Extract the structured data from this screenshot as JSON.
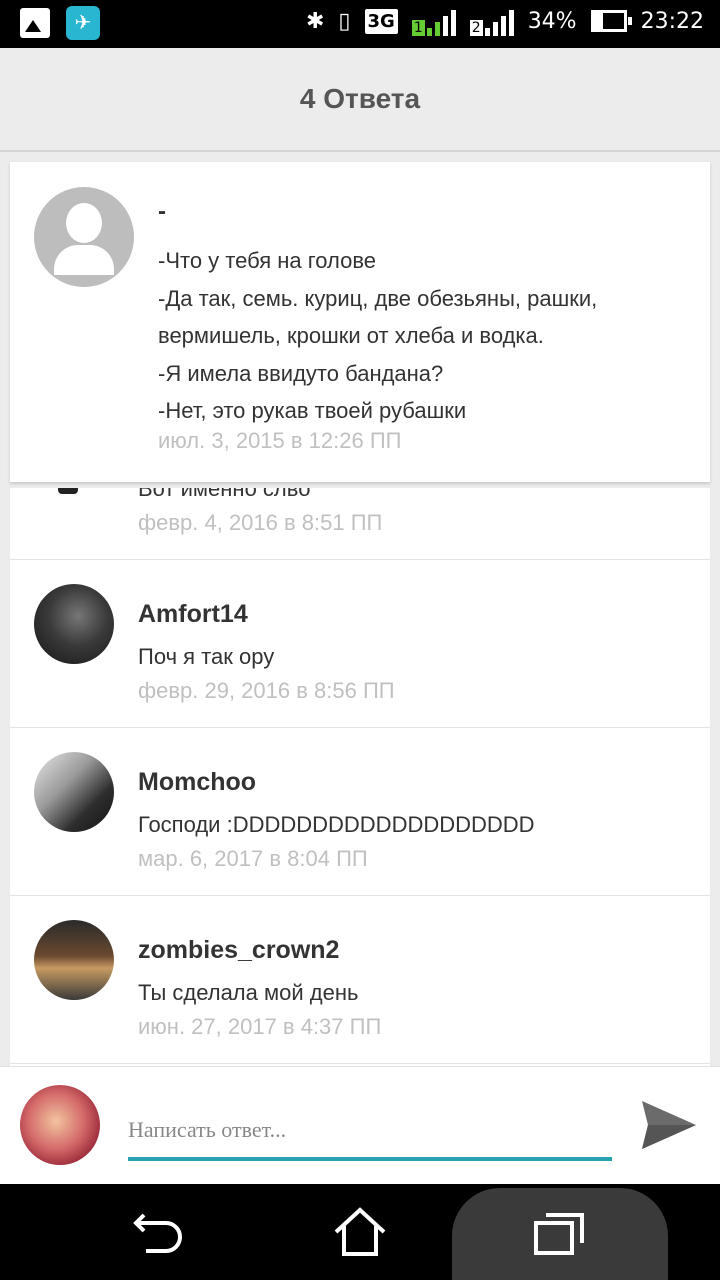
{
  "status_bar": {
    "network": "3G",
    "sim1": "1",
    "sim2": "2",
    "battery": "34%",
    "time": "23:22",
    "icons": [
      "image-icon",
      "app-icon",
      "bluetooth-icon",
      "vibrate-icon",
      "signal-icon",
      "battery-icon"
    ]
  },
  "header": {
    "title": "4 Ответа"
  },
  "original_post": {
    "author": "-",
    "lines": [
      "-Что у тебя на голове",
      "-Да так, семь. куриц, две обезьяны, рашки, вермишель, крошки от хлеба и водка.",
      "-Я имела ввидуто бандана?",
      "-Нет, это рукав твоей рубашки"
    ],
    "date": "июл. 3, 2015 в 12:26 ПП"
  },
  "replies": [
    {
      "author": "",
      "text": "Вот именно слво",
      "date": "февр. 4, 2016 в 8:51 ПП"
    },
    {
      "author": "Amfort14",
      "text": "Поч я так ору",
      "date": "февр. 29, 2016 в 8:56 ПП"
    },
    {
      "author": "Momchoo",
      "text": "Господи :DDDDDDDDDDDDDDDDDDD",
      "date": "мар. 6, 2017 в 8:04 ПП"
    },
    {
      "author": "zombies_crown2",
      "text": "Ты сделала мой день",
      "date": "июн. 27, 2017 в 4:37 ПП"
    }
  ],
  "compose": {
    "placeholder": "Написать ответ...",
    "value": ""
  },
  "colors": {
    "accent": "#27a3ad",
    "date_text": "#c0c0c0",
    "background": "#ececec"
  }
}
